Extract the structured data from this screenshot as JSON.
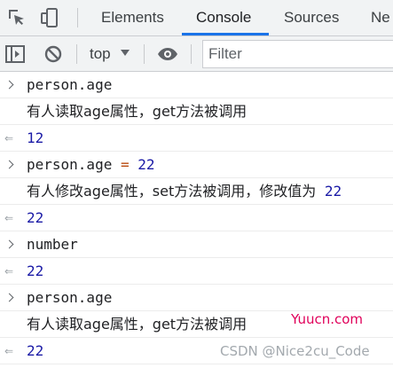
{
  "tabs": {
    "elements": "Elements",
    "console": "Console",
    "sources": "Sources",
    "network_partial": "Ne"
  },
  "toolbar": {
    "context": "top",
    "filter_placeholder": "Filter"
  },
  "console_lines": [
    {
      "type": "input",
      "text": "person.age"
    },
    {
      "type": "log",
      "text": "有人读取age属性，get方法被调用"
    },
    {
      "type": "result",
      "text": "12"
    },
    {
      "type": "input",
      "expr": "person.age",
      "op": "=",
      "value": "22"
    },
    {
      "type": "log",
      "text": "有人修改age属性，set方法被调用，修改值为",
      "value": "22"
    },
    {
      "type": "result",
      "text": "22"
    },
    {
      "type": "input",
      "text": "number"
    },
    {
      "type": "result",
      "text": "22"
    },
    {
      "type": "input",
      "text": "person.age"
    },
    {
      "type": "log",
      "text": "有人读取age属性，get方法被调用"
    },
    {
      "type": "result",
      "text": "22"
    }
  ],
  "watermarks": {
    "site": "Yuucn.com",
    "author": "CSDN @Nice2cu_Code"
  },
  "icons": {
    "inspect": "inspect-element-icon",
    "device": "device-toolbar-icon",
    "sidebar": "show-sidebar-icon",
    "clear": "clear-console-icon",
    "eye": "live-expression-icon",
    "prompt": "chevron-right-icon",
    "result": "result-arrow-icon"
  },
  "colors": {
    "accent": "#1a73e8",
    "result": "#1a1aa6",
    "operator": "#b8470b",
    "watermark_site": "#e0005a"
  }
}
